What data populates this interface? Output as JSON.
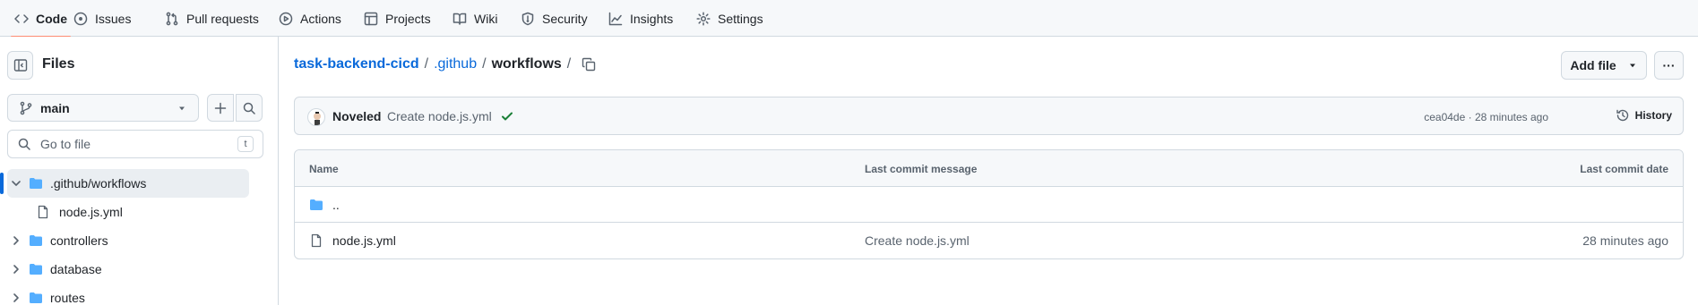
{
  "nav": {
    "items": [
      {
        "label": "Code",
        "icon": "code-icon"
      },
      {
        "label": "Issues",
        "icon": "issue-icon"
      },
      {
        "label": "Pull requests",
        "icon": "pull-request-icon"
      },
      {
        "label": "Actions",
        "icon": "play-icon"
      },
      {
        "label": "Projects",
        "icon": "table-icon"
      },
      {
        "label": "Wiki",
        "icon": "book-icon"
      },
      {
        "label": "Security",
        "icon": "shield-icon"
      },
      {
        "label": "Insights",
        "icon": "graph-icon"
      },
      {
        "label": "Settings",
        "icon": "gear-icon"
      }
    ],
    "active": "Code"
  },
  "sidebar": {
    "title": "Files",
    "branch": "main",
    "search_placeholder": "Go to file",
    "search_shortcut": "t",
    "tree": [
      {
        "label": ".github/workflows",
        "type": "folder",
        "expanded": true,
        "selected": true
      },
      {
        "label": "node.js.yml",
        "type": "file"
      },
      {
        "label": "controllers",
        "type": "folder"
      },
      {
        "label": "database",
        "type": "folder"
      },
      {
        "label": "routes",
        "type": "folder"
      }
    ]
  },
  "breadcrumb": {
    "repo": "task-backend-cicd",
    "sep1": "/",
    "dir": ".github",
    "sep2": "/",
    "current": "workflows",
    "sep3": "/"
  },
  "header_buttons": {
    "add_file": "Add file",
    "more": "···"
  },
  "commit": {
    "author": "Noveled",
    "message": "Create node.js.yml",
    "meta": "cea04de · 28 minutes ago",
    "history": "History",
    "status_color": "#1a7f37"
  },
  "table": {
    "headers": {
      "name": "Name",
      "message": "Last commit message",
      "date": "Last commit date"
    },
    "rows": [
      {
        "name": "..",
        "type": "folder",
        "message": "",
        "date": ""
      },
      {
        "name": "node.js.yml",
        "type": "file",
        "message": "Create node.js.yml",
        "date": "28 minutes ago"
      }
    ]
  },
  "colors": {
    "accent": "#0969da",
    "folder": "#54aeff",
    "active_underline": "#fd8c73"
  }
}
